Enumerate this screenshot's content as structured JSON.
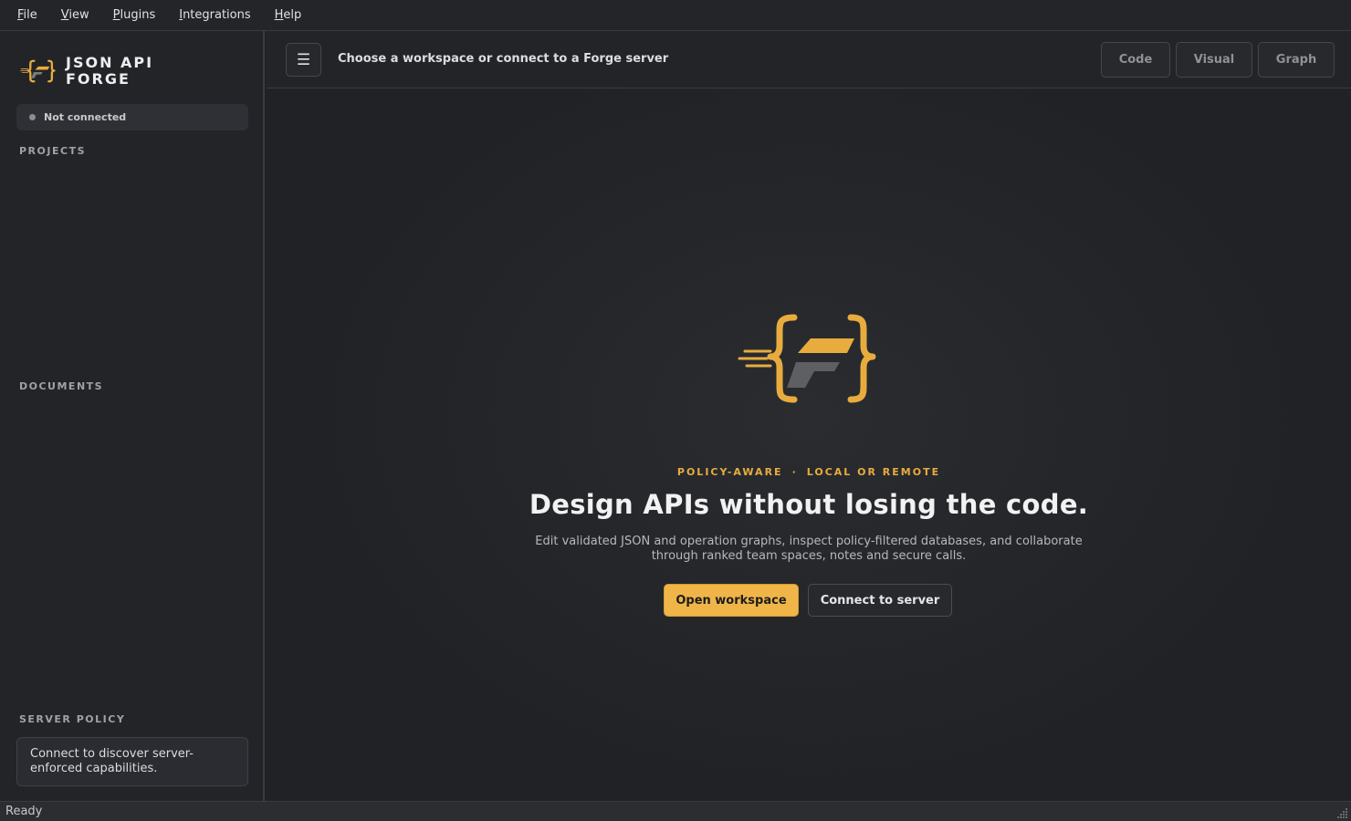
{
  "menu": {
    "items": [
      {
        "accel": "F",
        "rest": "ile"
      },
      {
        "accel": "V",
        "rest": "iew"
      },
      {
        "accel": "P",
        "rest": "lugins"
      },
      {
        "accel": "I",
        "rest": "ntegrations"
      },
      {
        "accel": "H",
        "rest": "elp"
      }
    ]
  },
  "sidebar": {
    "brand_line1": "JSON API",
    "brand_line2": "FORGE",
    "connection_status": "Not connected",
    "projects_label": "PROJECTS",
    "documents_label": "DOCUMENTS",
    "server_policy_label": "SERVER POLICY",
    "server_policy_text": "Connect to discover server-enforced capabilities."
  },
  "topbar": {
    "menu_icon": "hamburger-icon",
    "title": "Choose a workspace or connect to a Forge server",
    "modes": [
      "Code",
      "Visual",
      "Graph"
    ]
  },
  "hero": {
    "eyebrow_left": "POLICY-AWARE",
    "eyebrow_sep": "·",
    "eyebrow_right": "LOCAL OR REMOTE",
    "headline": "Design APIs without losing the code.",
    "subtext": "Edit validated JSON and operation graphs, inspect policy-filtered databases, and collaborate through ranked team spaces, notes and secure calls.",
    "primary_button": "Open workspace",
    "secondary_button": "Connect to server"
  },
  "statusbar": {
    "text": "Ready"
  },
  "colors": {
    "accent": "#f0b548",
    "background": "#202226",
    "sidebar": "#222428"
  }
}
